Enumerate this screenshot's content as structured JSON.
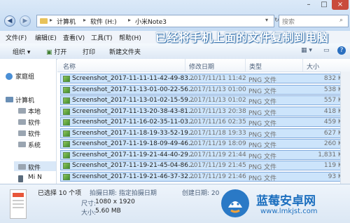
{
  "breadcrumb": [
    "计算机",
    "软件 (H:)",
    "小米Note3"
  ],
  "search": {
    "placeholder": "搜索"
  },
  "menu": [
    "文件(F)",
    "编辑(E)",
    "查看(V)",
    "工具(T)",
    "帮助(H)"
  ],
  "overlay_text": "已经将手机上面的文件复制到电脑",
  "toolbar": {
    "organize": "组织",
    "open": "打开",
    "print": "打印",
    "new_folder": "新建文件夹"
  },
  "nav": {
    "homegroup": "家庭组",
    "computer": "计算机",
    "items": [
      "本地",
      "软件",
      "软件",
      "系统",
      "软件",
      "Mi N"
    ]
  },
  "columns": {
    "name": "名称",
    "date": "修改日期",
    "type": "类型",
    "size": "大小"
  },
  "files": [
    {
      "name": "Screenshot_2017-11-11-11-42-49-83...",
      "date": "2017/11/11 11:42",
      "type": "PNG 文件",
      "size": "832 KB"
    },
    {
      "name": "Screenshot_2017-11-13-01-00-22-56...",
      "date": "2017/11/13 01:00",
      "type": "PNG 文件",
      "size": "538 KB"
    },
    {
      "name": "Screenshot_2017-11-13-01-02-15-59...",
      "date": "2017/11/13 01:02",
      "type": "PNG 文件",
      "size": "557 KB"
    },
    {
      "name": "Screenshot_2017-11-13-20-38-43-81...",
      "date": "2017/11/13 20:38",
      "type": "PNG 文件",
      "size": "418 KB"
    },
    {
      "name": "Screenshot_2017-11-16-02-35-11-03...",
      "date": "2017/11/16 02:35",
      "type": "PNG 文件",
      "size": "459 KB"
    },
    {
      "name": "Screenshot_2017-11-18-19-33-52-19...",
      "date": "2017/11/18 19:33",
      "type": "PNG 文件",
      "size": "627 KB"
    },
    {
      "name": "Screenshot_2017-11-19-18-09-49-46...",
      "date": "2017/11/19 18:09",
      "type": "PNG 文件",
      "size": "260 KB"
    },
    {
      "name": "Screenshot_2017-11-19-21-44-40-29...",
      "date": "2017/11/19 21:44",
      "type": "PNG 文件",
      "size": "1,831 KB"
    },
    {
      "name": "Screenshot_2017-11-19-21-45-04-86...",
      "date": "2017/11/19 21:45",
      "type": "PNG 文件",
      "size": "119 KB"
    },
    {
      "name": "Screenshot_2017-11-19-21-46-37-32...",
      "date": "2017/11/19 21:46",
      "type": "PNG 文件",
      "size": "93 KB"
    }
  ],
  "details": {
    "selected": "已选择 10 个项",
    "shot_date": "拍摄日期: 指定拍摄日期",
    "created": "创建日期: 20",
    "dimensions_label": "尺寸:",
    "dimensions": "1080 x 1920",
    "size_label": "大小:",
    "size": "5.60 MB"
  },
  "watermark": {
    "title": "蓝莓安卓网",
    "url": "www.lmkjst.com"
  }
}
